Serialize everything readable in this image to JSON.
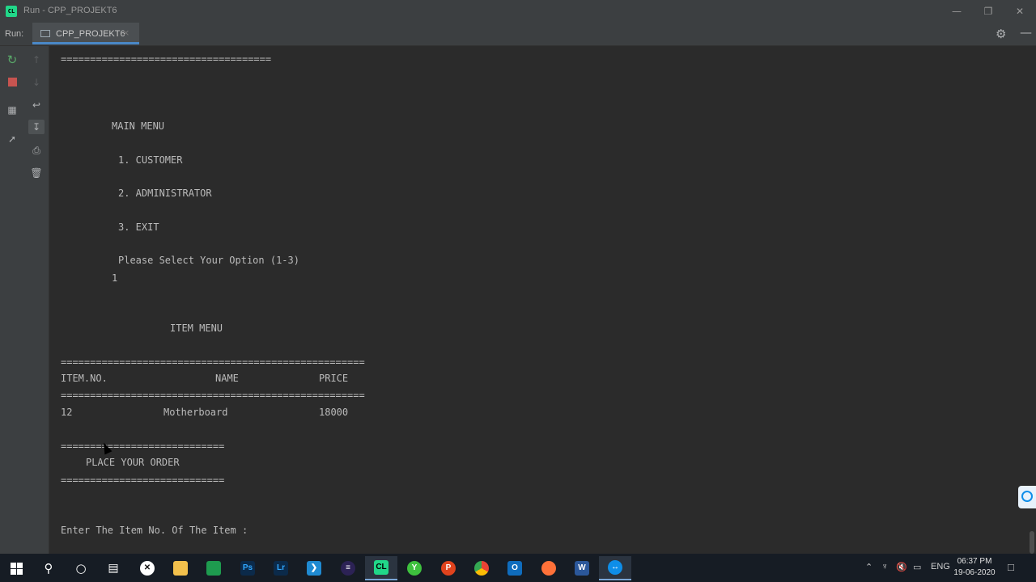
{
  "window": {
    "title": "Run - CPP_PROJEKT6",
    "app_icon_text": "CL",
    "minimize_icon": "minimize-icon",
    "restore_icon": "restore-icon",
    "close_icon": "close-icon"
  },
  "runbar": {
    "label": "Run:",
    "tab_label": "CPP_PROJEKT6",
    "tab_close": "×"
  },
  "console": {
    "lines": [
      "====================================",
      "MAIN MENU",
      "1. CUSTOMER",
      "2. ADMINISTRATOR",
      "3. EXIT",
      "Please Select Your Option (1-3)",
      "1",
      "ITEM MENU",
      "====================================================",
      "ITEM.NO.",
      "NAME",
      "PRICE",
      "====================================================",
      "12",
      "Motherboard",
      "18000",
      "============================",
      "PLACE YOUR ORDER",
      "============================",
      "Enter The Item No. Of The Item :"
    ]
  },
  "tray": {
    "lang": "ENG",
    "time": "06:37 PM",
    "date": "19-06-2020"
  },
  "taskbar": {
    "ps_label": "Ps",
    "lr_label": "Lr",
    "word_label": "W"
  },
  "colors": {
    "console_bg": "#2b2b2b",
    "panel_bg": "#3c3f41",
    "rerun_green": "#59a869",
    "stop_red": "#c75450",
    "taskbar_bg": "#161c24"
  }
}
